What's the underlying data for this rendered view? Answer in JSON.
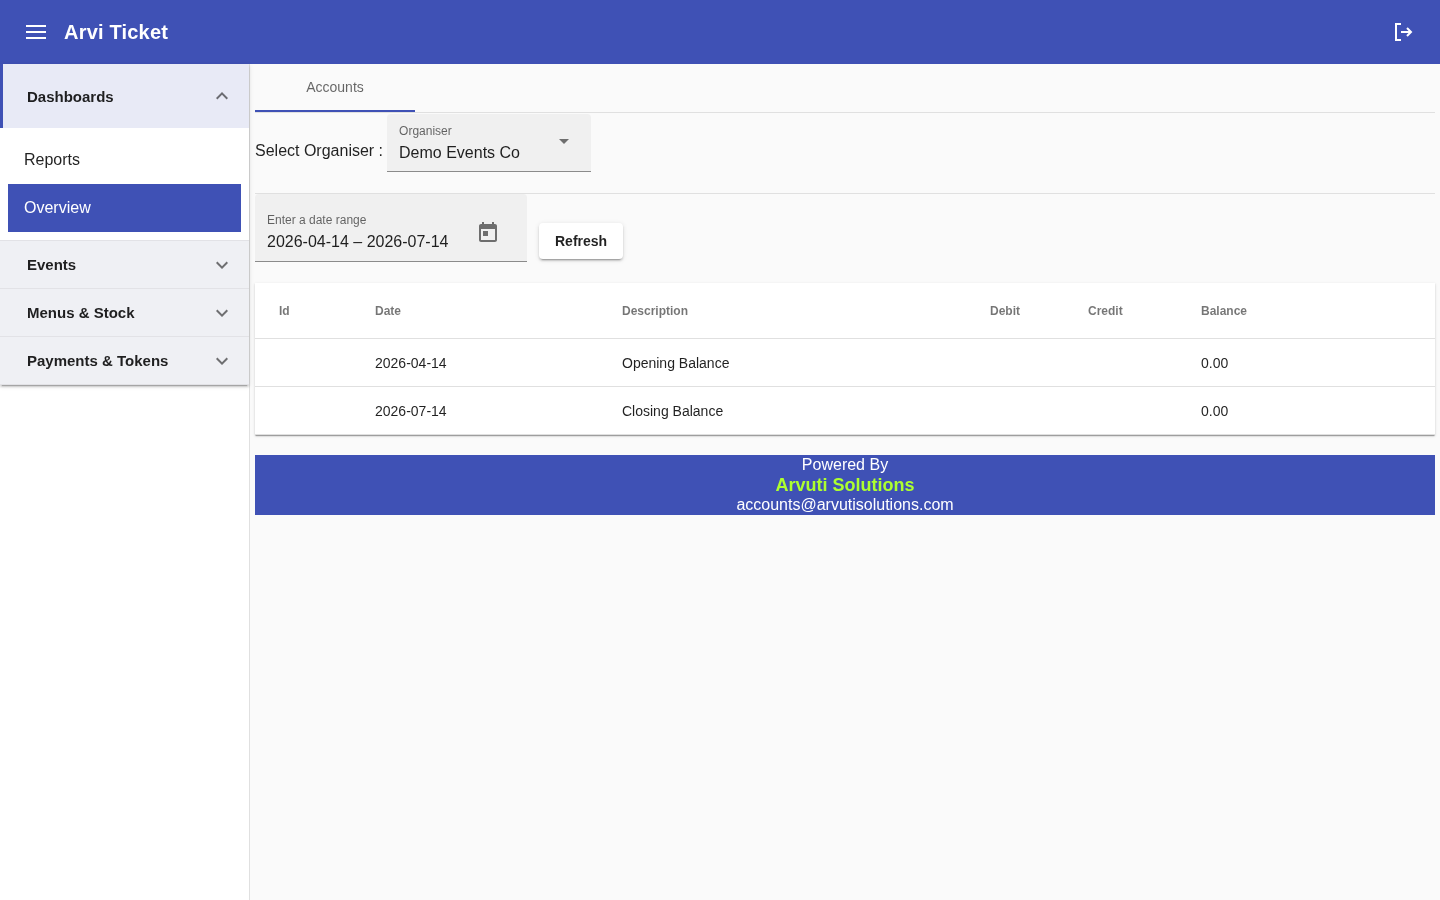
{
  "app_bar": {
    "title": "Arvi Ticket"
  },
  "sidebar": {
    "sections": [
      {
        "label": "Dashboards",
        "expanded": true,
        "children": [
          {
            "label": "Reports",
            "selected": false
          },
          {
            "label": "Overview",
            "selected": true
          }
        ]
      },
      {
        "label": "Events",
        "expanded": false
      },
      {
        "label": "Menus & Stock",
        "expanded": false
      },
      {
        "label": "Payments & Tokens",
        "expanded": false
      }
    ]
  },
  "tabs": [
    {
      "label": "Accounts",
      "selected": true
    }
  ],
  "organiser_filter": {
    "label": "Select Organiser :",
    "select": {
      "label": "Organiser",
      "value": "Demo Events Co"
    }
  },
  "date_range": {
    "label": "Enter a date range",
    "value": "2026-04-14 – 2026-07-14"
  },
  "refresh_button": "Refresh",
  "table": {
    "columns": [
      "Id",
      "Date",
      "Description",
      "Debit",
      "Credit",
      "Balance"
    ],
    "rows": [
      {
        "date": "2026-04-14",
        "description": "Opening Balance",
        "balance": "0.00"
      },
      {
        "date": "2026-07-14",
        "description": "Closing Balance",
        "balance": "0.00"
      }
    ]
  },
  "footer": {
    "powered_by": "Powered By",
    "company": "Arvuti Solutions",
    "email": "accounts@arvutisolutions.com"
  }
}
